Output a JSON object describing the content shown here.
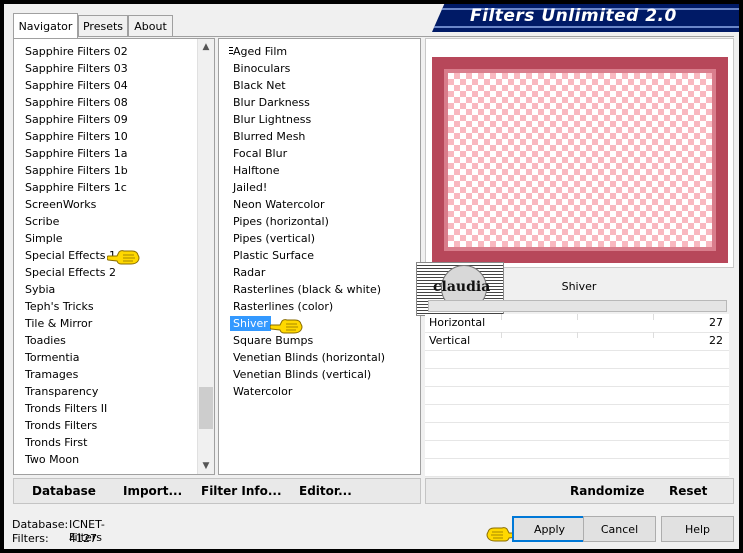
{
  "app": {
    "title": "Filters Unlimited 2.0"
  },
  "tabs": [
    {
      "label": "Navigator",
      "active": true
    },
    {
      "label": "Presets",
      "active": false
    },
    {
      "label": "About",
      "active": false
    }
  ],
  "categories": [
    "Sapphire Filters 02",
    "Sapphire Filters 03",
    "Sapphire Filters 04",
    "Sapphire Filters 08",
    "Sapphire Filters 09",
    "Sapphire Filters 10",
    "Sapphire Filters 1a",
    "Sapphire Filters 1b",
    "Sapphire Filters 1c",
    "ScreenWorks",
    "Scribe",
    "Simple",
    "Special Effects 1",
    "Special Effects 2",
    "Sybia",
    "Teph's Tricks",
    "Tile & Mirror",
    "Toadies",
    "Tormentia",
    "Tramages",
    "Transparency",
    "Tronds Filters II",
    "Tronds Filters",
    "Tronds First",
    "Two Moon"
  ],
  "filters": [
    "Aged Film",
    "Binoculars",
    "Black Net",
    "Blur Darkness",
    "Blur Lightness",
    "Blurred Mesh",
    "Focal Blur",
    "Halftone",
    "Jailed!",
    "Neon Watercolor",
    "Pipes (horizontal)",
    "Pipes (vertical)",
    "Plastic Surface",
    "Radar",
    "Rasterlines (black & white)",
    "Rasterlines (color)",
    "Shiver",
    "Square Bumps",
    "Venetian Blinds (horizontal)",
    "Venetian Blinds (vertical)",
    "Watercolor"
  ],
  "selected_category": "Special Effects 1",
  "selected_filter": "Shiver",
  "watermark": {
    "text": "claudia"
  },
  "params": {
    "filter_name": "Shiver",
    "rows": [
      {
        "label": "Horizontal",
        "value": "27"
      },
      {
        "label": "Vertical",
        "value": "22"
      }
    ]
  },
  "buttons": {
    "database": "Database",
    "import": "Import...",
    "filter_info": "Filter Info...",
    "editor": "Editor...",
    "randomize": "Randomize",
    "reset": "Reset",
    "apply": "Apply",
    "cancel": "Cancel",
    "help": "Help"
  },
  "status": {
    "database_label": "Database:",
    "database_value": "ICNET-Filters",
    "filters_label": "Filters:",
    "filters_value": "4127"
  },
  "colors": {
    "selection": "#3399ff",
    "title_bar": "#001a66",
    "preview_frame": "#b7475a",
    "checker": "#f9b8c0"
  }
}
